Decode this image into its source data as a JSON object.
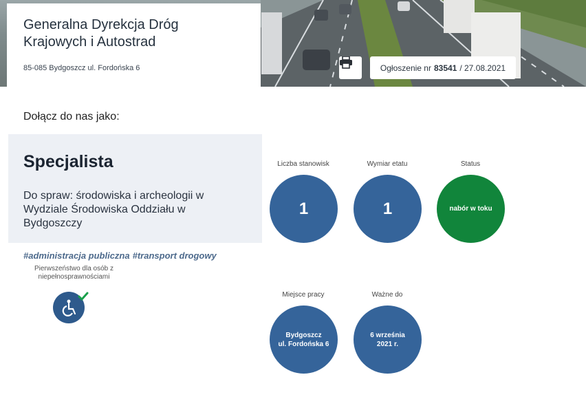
{
  "header": {
    "org_name": "Generalna Dyrekcja Dróg Krajowych i Autostrad",
    "address": "85-085 Bydgoszcz ul. Fordońska 6",
    "print_icon": "printer-icon",
    "ad_label": "Ogłoszenie nr",
    "ad_number": "83541",
    "ad_date": "/ 27.08.2021"
  },
  "join_label": "Dołącz do nas jako:",
  "position": {
    "title": "Specjalista",
    "description": "Do spraw: środowiska i archeologii w Wydziale Środowiska Oddziału w Bydgoszczy"
  },
  "tags": [
    "#administracja publiczna",
    "#transport drogowy"
  ],
  "priority_text": "Pierwszeństwo dla osób z niepełnosprawnościami",
  "priority_icon": "wheelchair-icon",
  "stats": {
    "positions_label": "Liczba stanowisk",
    "positions_value": "1",
    "fte_label": "Wymiar etatu",
    "fte_value": "1",
    "status_label": "Status",
    "status_value": "nabór w toku",
    "workplace_label": "Miejsce pracy",
    "workplace_value_line1": "Bydgoszcz",
    "workplace_value_line2": "ul. Fordońska 6",
    "valid_label": "Ważne do",
    "valid_value_line1": "6 września",
    "valid_value_line2": "2021 r."
  },
  "colors": {
    "circle_blue": "#35649a",
    "status_green": "#11853b",
    "panel_bg": "#edf0f5"
  }
}
